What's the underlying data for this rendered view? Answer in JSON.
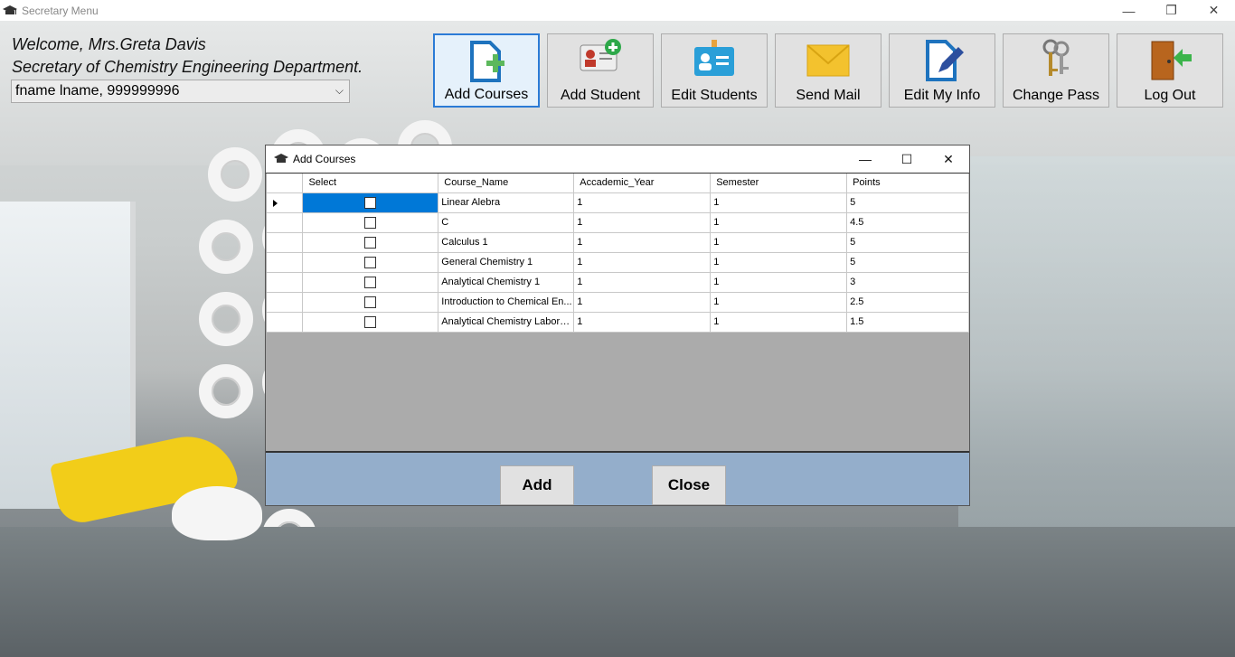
{
  "window": {
    "title": "Secretary Menu",
    "minimize": "—",
    "restore": "❐",
    "close": "✕"
  },
  "header": {
    "welcome_line1": "Welcome, Mrs.Greta Davis",
    "welcome_line2": "Secretary of Chemistry Engineering Department.",
    "user_select_value": "fname lname, 999999996"
  },
  "toolbar": {
    "add_courses": "Add Courses",
    "add_student": "Add Student",
    "edit_students": "Edit Students",
    "send_mail": "Send Mail",
    "edit_my_info": "Edit My Info",
    "change_pass": "Change Pass",
    "log_out": "Log Out"
  },
  "dialog": {
    "title": "Add Courses",
    "minimize": "—",
    "maximize": "☐",
    "close": "✕",
    "columns": [
      "Select",
      "Course_Name",
      "Accademic_Year",
      "Semester",
      "Points"
    ],
    "rows": [
      {
        "course": "Linear Alebra",
        "year": "1",
        "semester": "1",
        "points": "5"
      },
      {
        "course": "C",
        "year": "1",
        "semester": "1",
        "points": "4.5"
      },
      {
        "course": "Calculus 1",
        "year": "1",
        "semester": "1",
        "points": "5"
      },
      {
        "course": "General Chemistry 1",
        "year": "1",
        "semester": "1",
        "points": "5"
      },
      {
        "course": "Analytical Chemistry 1",
        "year": "1",
        "semester": "1",
        "points": "3"
      },
      {
        "course": "Introduction to Chemical En...",
        "year": "1",
        "semester": "1",
        "points": "2.5"
      },
      {
        "course": "Analytical Chemistry Laborat...",
        "year": "1",
        "semester": "1",
        "points": "1.5"
      }
    ],
    "add_button": "Add",
    "close_button": "Close"
  },
  "colors": {
    "selection": "#0078d7",
    "footer": "#94aecb",
    "active_toolbar_border": "#2b7bd6"
  }
}
